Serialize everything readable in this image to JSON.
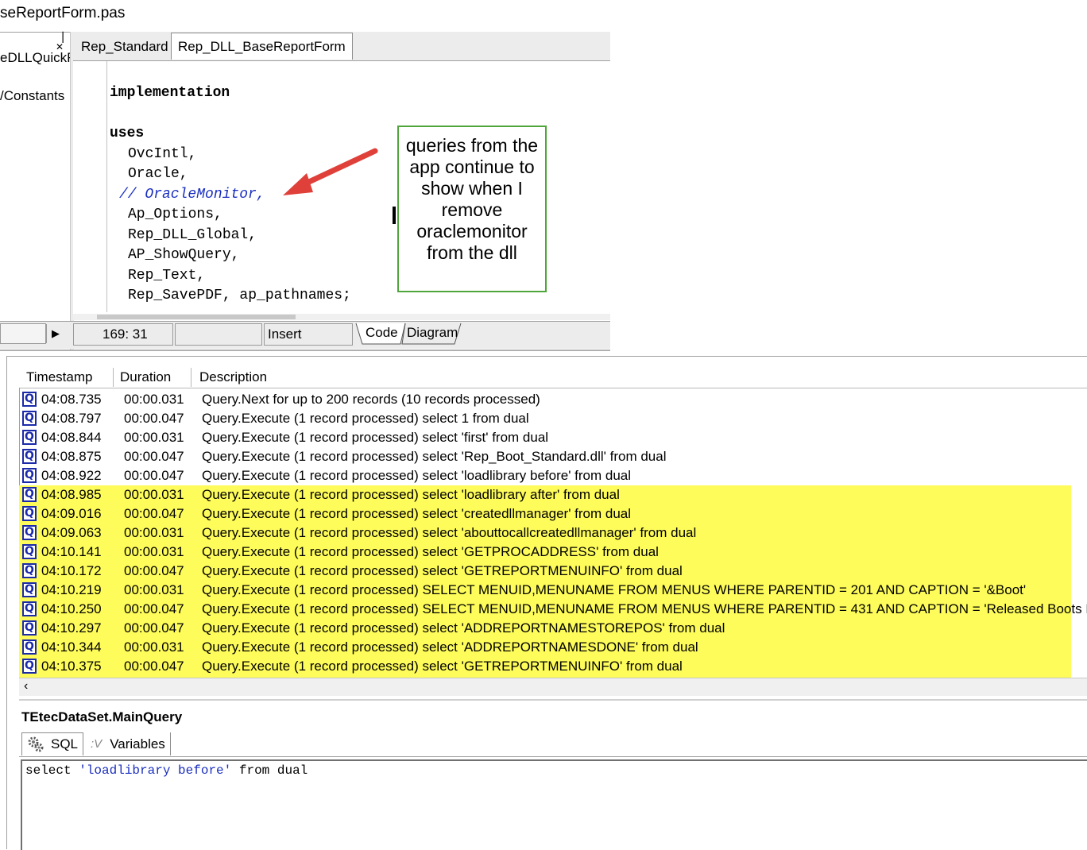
{
  "file_title": "seReportForm.pas",
  "project_tree": {
    "items": [
      "eDLLQuickF",
      "/Constants"
    ]
  },
  "editor_tabs": [
    {
      "label": "Rep_Standard"
    },
    {
      "label": "Rep_DLL_BaseReportForm",
      "active": true
    }
  ],
  "code": {
    "lines": [
      {
        "text": "implementation",
        "style": "keyword"
      },
      {
        "text": "uses",
        "style": "keyword"
      },
      {
        "text": "OvcIntl,"
      },
      {
        "text": "Oracle,"
      },
      {
        "text": "// OracleMonitor,",
        "style": "comment"
      },
      {
        "text": "Ap_Options,"
      },
      {
        "text": "Rep_DLL_Global,"
      },
      {
        "text": "AP_ShowQuery,"
      },
      {
        "text": "Rep_Text,"
      },
      {
        "text": "Rep_SavePDF, ap_pathnames;"
      }
    ]
  },
  "status_bar": {
    "position": "169:  31",
    "mode": "Insert",
    "tab_code": "Code",
    "tab_diagram": "Diagram"
  },
  "annotation": {
    "text": "queries from the app continue to show when I remove oraclemonitor from the dll",
    "border_color": "#4ea63a",
    "arrow_color": "#e0403a"
  },
  "monitor": {
    "columns": [
      "Timestamp",
      "Duration",
      "Description"
    ],
    "highlight_color": "#fefc5a",
    "rows": [
      {
        "timestamp": "04:08.735",
        "duration": "00:00.031",
        "description": "Query.Next for up to 200 records (10 records processed)"
      },
      {
        "timestamp": "04:08.797",
        "duration": "00:00.047",
        "description": "Query.Execute (1 record processed) select 1 from dual"
      },
      {
        "timestamp": "04:08.844",
        "duration": "00:00.031",
        "description": "Query.Execute (1 record processed) select 'first' from dual"
      },
      {
        "timestamp": "04:08.875",
        "duration": "00:00.047",
        "description": "Query.Execute (1 record processed) select 'Rep_Boot_Standard.dll' from dual"
      },
      {
        "timestamp": "04:08.922",
        "duration": "00:00.047",
        "description": "Query.Execute (1 record processed) select 'loadlibrary before' from dual"
      },
      {
        "timestamp": "04:08.985",
        "duration": "00:00.031",
        "description": "Query.Execute (1 record processed) select 'loadlibrary after' from dual"
      },
      {
        "timestamp": "04:09.016",
        "duration": "00:00.047",
        "description": "Query.Execute (1 record processed) select 'createdllmanager' from dual"
      },
      {
        "timestamp": "04:09.063",
        "duration": "00:00.031",
        "description": "Query.Execute (1 record processed) select 'abouttocallcreatedllmanager' from dual"
      },
      {
        "timestamp": "04:10.141",
        "duration": "00:00.031",
        "description": "Query.Execute (1 record processed) select 'GETPROCADDRESS' from dual"
      },
      {
        "timestamp": "04:10.172",
        "duration": "00:00.047",
        "description": "Query.Execute (1 record processed) select 'GETREPORTMENUINFO' from dual"
      },
      {
        "timestamp": "04:10.219",
        "duration": "00:00.031",
        "description": "Query.Execute (1 record processed) SELECT MENUID,MENUNAME FROM MENUS   WHERE PARENTID = 201   AND CAPTION = '&Boot'"
      },
      {
        "timestamp": "04:10.250",
        "duration": "00:00.047",
        "description": "Query.Execute (1 record processed) SELECT MENUID,MENUNAME FROM MENUS   WHERE PARENTID = 431   AND CAPTION = 'Released Boots Pendi"
      },
      {
        "timestamp": "04:10.297",
        "duration": "00:00.047",
        "description": "Query.Execute (1 record processed) select 'ADDREPORTNAMESTOREPOS' from dual"
      },
      {
        "timestamp": "04:10.344",
        "duration": "00:00.031",
        "description": "Query.Execute (1 record processed) select 'ADDREPORTNAMESDONE' from dual"
      },
      {
        "timestamp": "04:10.375",
        "duration": "00:00.047",
        "description": "Query.Execute (1 record processed) select 'GETREPORTMENUINFO' from dual"
      }
    ]
  },
  "query_detail": {
    "title": "TEtecDataSet.MainQuery",
    "tab_sql": "SQL",
    "tab_variables_prefix": ":V",
    "tab_variables": "Variables",
    "sql_keyword1": "select",
    "sql_string": "'loadlibrary before'",
    "sql_rest": "from dual"
  }
}
